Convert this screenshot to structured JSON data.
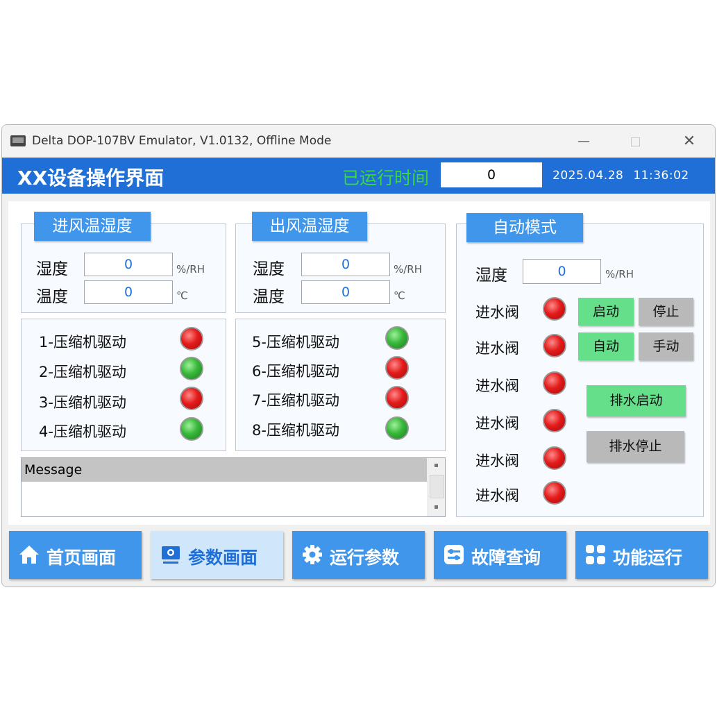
{
  "window": {
    "title": "Delta DOP-107BV Emulator, V1.0132, Offline Mode",
    "minimize": "—",
    "close": "✕"
  },
  "header": {
    "title": "XX设备操作界面",
    "runtime_label": "已运行时间",
    "runtime_value": "0",
    "date": "2025.04.28",
    "time": "11:36:02"
  },
  "inlet": {
    "title": "进风温湿度",
    "humidity_label": "湿度",
    "humidity_value": "0",
    "humidity_unit": "%/RH",
    "temp_label": "温度",
    "temp_value": "0",
    "temp_unit": "℃"
  },
  "outlet": {
    "title": "出风温湿度",
    "humidity_label": "湿度",
    "humidity_value": "0",
    "humidity_unit": "%/RH",
    "temp_label": "温度",
    "temp_value": "0",
    "temp_unit": "℃"
  },
  "compressors": [
    {
      "label": "1-压缩机驱动",
      "status": "red"
    },
    {
      "label": "2-压缩机驱动",
      "status": "green"
    },
    {
      "label": "3-压缩机驱动",
      "status": "red"
    },
    {
      "label": "4-压缩机驱动",
      "status": "green"
    },
    {
      "label": "5-压缩机驱动",
      "status": "green"
    },
    {
      "label": "6-压缩机驱动",
      "status": "red"
    },
    {
      "label": "7-压缩机驱动",
      "status": "red"
    },
    {
      "label": "8-压缩机驱动",
      "status": "green"
    }
  ],
  "message": {
    "header": "Message"
  },
  "auto": {
    "title": "自动模式",
    "humidity_label": "湿度",
    "humidity_value": "0",
    "humidity_unit": "%/RH",
    "valves": [
      {
        "label": "进水阀",
        "status": "red"
      },
      {
        "label": "进水阀",
        "status": "red"
      },
      {
        "label": "进水阀",
        "status": "red"
      },
      {
        "label": "进水阀",
        "status": "red"
      },
      {
        "label": "进水阀",
        "status": "red"
      },
      {
        "label": "进水阀",
        "status": "red"
      }
    ],
    "start": "启动",
    "stop": "停止",
    "auto": "自动",
    "manual": "手动",
    "drain_start": "排水启动",
    "drain_stop": "排水停止"
  },
  "nav": [
    {
      "label": "首页画面",
      "icon": "home-icon",
      "active": false
    },
    {
      "label": "参数画面",
      "icon": "monitor-icon",
      "active": true
    },
    {
      "label": "运行参数",
      "icon": "gear-icon",
      "active": false
    },
    {
      "label": "故障查询",
      "icon": "sliders-icon",
      "active": false
    },
    {
      "label": "功能运行",
      "icon": "apps-icon",
      "active": false
    }
  ]
}
